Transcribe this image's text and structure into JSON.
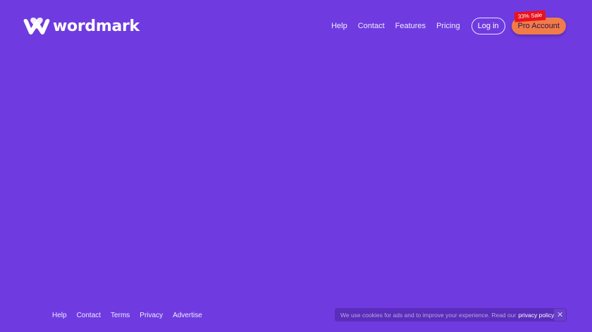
{
  "brand": {
    "name": "wordmark",
    "logo_icon": "w-heart-logo"
  },
  "nav": {
    "links": [
      "Help",
      "Contact",
      "Features",
      "Pricing"
    ],
    "login_label": "Log in",
    "pro_label": "Pro Account",
    "sale_badge": "33% Sale"
  },
  "footer": {
    "links": [
      "Help",
      "Contact",
      "Terms",
      "Privacy",
      "Advertise"
    ]
  },
  "cookie": {
    "text": "We use cookies for ads and to improve your experience. Read our",
    "link_label": "privacy policy",
    "close_icon": "close-icon"
  },
  "colors": {
    "background": "#6f3be0",
    "pro_button": "#f27b4a",
    "sale_badge": "#e8121f",
    "cookie_bar": "#5b2dbb"
  }
}
